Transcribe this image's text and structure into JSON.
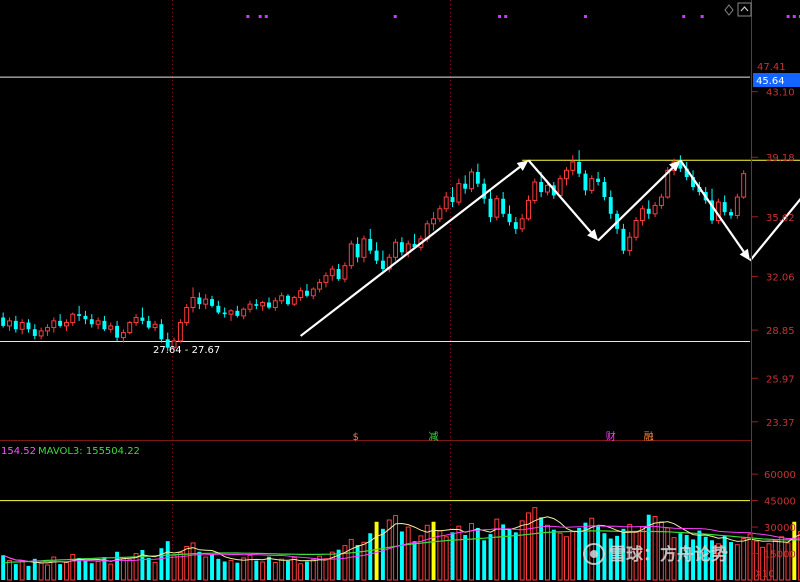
{
  "chart_data": [
    {
      "type": "candlestick",
      "panel": "price",
      "y_ticks": [
        "43.10",
        "39.18",
        "35.62",
        "32.06",
        "28.85",
        "25.97",
        "23.37"
      ],
      "y_tick_values": [
        43.1,
        39.18,
        35.62,
        32.06,
        28.85,
        25.97,
        23.37
      ],
      "ylim": [
        22.4,
        48.1
      ],
      "top_tick_partial": "47.41",
      "current_price_tag": "45.64",
      "range_label": "27.64 - 27.67",
      "horizontal_lines": [
        44.0,
        28.2
      ],
      "neckline": 39.0,
      "event_markers": [
        {
          "label": "$",
          "index": 56,
          "color": "#e87a5a"
        },
        {
          "label": "减",
          "index": 68,
          "color": "#3cdc3c"
        },
        {
          "label": "财",
          "index": 96,
          "color": "#ff3cff"
        },
        {
          "label": "融",
          "index": 102,
          "color": "#ff8a3c"
        }
      ],
      "arrows": [
        {
          "from": [
            47,
            28.5
          ],
          "to": [
            83,
            39.0
          ]
        },
        {
          "from": [
            83,
            39.0
          ],
          "to": [
            94,
            34.2
          ]
        },
        {
          "from": [
            94,
            34.2
          ],
          "to": [
            107,
            39.0
          ]
        },
        {
          "from": [
            107,
            39.0
          ],
          "to": [
            118,
            33.0
          ]
        },
        {
          "from": [
            118,
            33.0
          ],
          "to": [
            131,
            39.0
          ]
        },
        {
          "from": [
            131,
            39.0
          ],
          "to": [
            143,
            35.5
          ]
        },
        {
          "from": [
            147,
            37.0
          ],
          "to": [
            162,
            47.8
          ]
        }
      ],
      "candles": [
        [
          29.6,
          29.9,
          29.0,
          29.1
        ],
        [
          29.1,
          29.6,
          28.8,
          29.4
        ],
        [
          29.4,
          29.7,
          28.7,
          28.9
        ],
        [
          28.9,
          29.5,
          28.6,
          29.3
        ],
        [
          29.3,
          29.5,
          28.7,
          28.9
        ],
        [
          28.9,
          29.2,
          28.3,
          28.5
        ],
        [
          28.5,
          29.0,
          28.3,
          28.8
        ],
        [
          28.8,
          29.2,
          28.5,
          29.0
        ],
        [
          29.0,
          29.6,
          28.7,
          29.4
        ],
        [
          29.4,
          29.8,
          29.0,
          29.1
        ],
        [
          29.1,
          29.5,
          28.8,
          29.3
        ],
        [
          29.3,
          29.9,
          29.1,
          29.8
        ],
        [
          29.8,
          30.3,
          29.4,
          29.7
        ],
        [
          29.7,
          30.0,
          29.2,
          29.5
        ],
        [
          29.5,
          29.8,
          29.0,
          29.2
        ],
        [
          29.2,
          29.6,
          28.9,
          29.4
        ],
        [
          29.4,
          29.7,
          28.8,
          28.9
        ],
        [
          28.9,
          29.3,
          28.7,
          29.1
        ],
        [
          29.1,
          29.4,
          28.2,
          28.4
        ],
        [
          28.4,
          28.9,
          28.1,
          28.7
        ],
        [
          28.7,
          29.4,
          28.6,
          29.3
        ],
        [
          29.3,
          29.8,
          29.1,
          29.6
        ],
        [
          29.6,
          30.2,
          29.2,
          29.4
        ],
        [
          29.4,
          29.7,
          28.9,
          29.0
        ],
        [
          29.0,
          29.4,
          28.8,
          29.2
        ],
        [
          29.2,
          29.5,
          28.1,
          28.3
        ],
        [
          28.3,
          28.7,
          27.6,
          27.8
        ],
        [
          27.8,
          28.4,
          27.6,
          28.2
        ],
        [
          28.2,
          29.5,
          28.1,
          29.3
        ],
        [
          29.3,
          30.4,
          29.1,
          30.2
        ],
        [
          30.2,
          31.4,
          29.9,
          30.8
        ],
        [
          30.8,
          31.1,
          30.1,
          30.4
        ],
        [
          30.4,
          31.0,
          30.1,
          30.7
        ],
        [
          30.7,
          30.9,
          30.2,
          30.3
        ],
        [
          30.3,
          30.6,
          29.8,
          29.9
        ],
        [
          29.9,
          30.2,
          29.6,
          29.8
        ],
        [
          29.8,
          30.1,
          29.4,
          30.0
        ],
        [
          30.0,
          30.3,
          29.6,
          29.7
        ],
        [
          29.7,
          30.2,
          29.5,
          30.1
        ],
        [
          30.1,
          30.6,
          29.9,
          30.4
        ],
        [
          30.4,
          30.7,
          30.1,
          30.3
        ],
        [
          30.3,
          30.6,
          30.0,
          30.5
        ],
        [
          30.5,
          30.8,
          30.1,
          30.2
        ],
        [
          30.2,
          30.8,
          30.0,
          30.6
        ],
        [
          30.6,
          31.1,
          30.4,
          30.9
        ],
        [
          30.9,
          31.0,
          30.3,
          30.4
        ],
        [
          30.4,
          30.9,
          30.3,
          30.8
        ],
        [
          30.8,
          31.4,
          30.6,
          31.2
        ],
        [
          31.2,
          31.6,
          30.8,
          30.9
        ],
        [
          30.9,
          31.4,
          30.7,
          31.3
        ],
        [
          31.3,
          31.9,
          31.1,
          31.7
        ],
        [
          31.7,
          32.3,
          31.4,
          32.1
        ],
        [
          32.1,
          32.7,
          31.8,
          32.5
        ],
        [
          32.5,
          32.8,
          31.8,
          31.9
        ],
        [
          31.9,
          32.9,
          31.7,
          32.7
        ],
        [
          32.7,
          34.2,
          32.5,
          34.0
        ],
        [
          34.0,
          34.4,
          32.9,
          33.2
        ],
        [
          33.2,
          34.5,
          32.9,
          34.3
        ],
        [
          34.3,
          34.9,
          33.4,
          33.6
        ],
        [
          33.6,
          34.1,
          32.8,
          33.0
        ],
        [
          33.0,
          33.6,
          32.3,
          32.5
        ],
        [
          32.5,
          33.4,
          32.3,
          33.2
        ],
        [
          33.2,
          34.3,
          33.0,
          34.1
        ],
        [
          34.1,
          34.4,
          33.3,
          33.5
        ],
        [
          33.5,
          34.2,
          33.2,
          34.0
        ],
        [
          34.0,
          34.6,
          33.7,
          33.8
        ],
        [
          33.8,
          34.5,
          33.6,
          34.3
        ],
        [
          34.3,
          35.4,
          34.1,
          35.2
        ],
        [
          35.2,
          35.9,
          34.8,
          35.5
        ],
        [
          35.5,
          36.3,
          35.3,
          36.1
        ],
        [
          36.1,
          37.1,
          35.9,
          36.8
        ],
        [
          36.8,
          37.4,
          36.2,
          36.5
        ],
        [
          36.5,
          37.9,
          36.3,
          37.6
        ],
        [
          37.6,
          38.1,
          37.0,
          37.3
        ],
        [
          37.3,
          38.5,
          37.1,
          38.3
        ],
        [
          38.3,
          38.8,
          37.4,
          37.6
        ],
        [
          37.6,
          37.9,
          36.4,
          36.7
        ],
        [
          36.7,
          37.3,
          35.3,
          35.6
        ],
        [
          35.6,
          36.9,
          35.4,
          36.7
        ],
        [
          36.7,
          37.1,
          35.6,
          35.8
        ],
        [
          35.8,
          36.3,
          35.1,
          35.3
        ],
        [
          35.3,
          35.6,
          34.6,
          34.9
        ],
        [
          34.9,
          35.8,
          34.7,
          35.5
        ],
        [
          35.5,
          36.9,
          35.4,
          36.6
        ],
        [
          36.6,
          37.9,
          36.4,
          37.7
        ],
        [
          37.7,
          38.3,
          36.8,
          37.1
        ],
        [
          37.1,
          37.8,
          36.9,
          37.5
        ],
        [
          37.5,
          37.7,
          36.7,
          36.9
        ],
        [
          36.9,
          38.1,
          36.8,
          37.9
        ],
        [
          37.9,
          38.6,
          37.5,
          38.4
        ],
        [
          38.4,
          39.3,
          38.1,
          38.9
        ],
        [
          38.9,
          39.6,
          38.0,
          38.2
        ],
        [
          38.2,
          38.4,
          36.9,
          37.2
        ],
        [
          37.2,
          38.1,
          37.0,
          37.9
        ],
        [
          37.9,
          38.3,
          37.5,
          37.7
        ],
        [
          37.7,
          38.0,
          36.6,
          36.8
        ],
        [
          36.8,
          37.2,
          35.5,
          35.8
        ],
        [
          35.8,
          36.0,
          34.6,
          34.9
        ],
        [
          34.9,
          35.2,
          33.4,
          33.6
        ],
        [
          33.6,
          34.7,
          33.3,
          34.4
        ],
        [
          34.4,
          35.6,
          34.2,
          35.4
        ],
        [
          35.4,
          36.3,
          35.1,
          36.1
        ],
        [
          36.1,
          36.6,
          35.5,
          35.8
        ],
        [
          35.8,
          36.5,
          35.6,
          36.3
        ],
        [
          36.3,
          37.0,
          36.1,
          36.8
        ],
        [
          36.8,
          38.6,
          36.7,
          38.4
        ],
        [
          38.4,
          39.1,
          38.1,
          38.9
        ],
        [
          38.9,
          39.3,
          38.3,
          38.5
        ],
        [
          38.5,
          38.9,
          37.8,
          38.0
        ],
        [
          38.0,
          38.4,
          37.2,
          37.4
        ],
        [
          37.4,
          37.7,
          36.9,
          37.1
        ],
        [
          37.1,
          37.4,
          36.4,
          36.6
        ],
        [
          36.6,
          37.3,
          35.2,
          35.4
        ],
        [
          35.4,
          36.7,
          35.2,
          36.5
        ],
        [
          36.5,
          36.9,
          35.7,
          35.9
        ],
        [
          35.9,
          36.1,
          35.5,
          35.7
        ],
        [
          35.7,
          37.0,
          35.5,
          36.8
        ],
        [
          36.8,
          38.4,
          36.7,
          38.2
        ]
      ]
    },
    {
      "type": "bar",
      "panel": "volume",
      "title_values": [
        "154.52",
        "MAVOL3: 155504.22"
      ],
      "y_ticks": [
        "60000",
        "45000",
        "30000",
        "15000"
      ],
      "y_tick_values": [
        60000,
        45000,
        30000,
        15000
      ],
      "ylim": [
        0,
        68000
      ],
      "axis_unit": "X10",
      "horizontal_line": 45000,
      "highlight_color": "#ffff00",
      "highlight_indices": [
        59,
        68,
        125,
        145
      ],
      "volumes": [
        14000,
        11000,
        9000,
        10500,
        8000,
        12000,
        9500,
        8500,
        13000,
        9000,
        10000,
        14500,
        12500,
        11000,
        9500,
        10500,
        13000,
        9000,
        16000,
        12000,
        11500,
        15000,
        17000,
        12500,
        10000,
        18000,
        22000,
        14000,
        15500,
        19000,
        21000,
        16000,
        13000,
        14500,
        12000,
        10500,
        11000,
        9800,
        12500,
        14000,
        11000,
        10200,
        13200,
        9900,
        11800,
        10900,
        12700,
        9200,
        10400,
        11600,
        13500,
        12100,
        15800,
        17200,
        19500,
        23000,
        19800,
        21400,
        26500,
        33000,
        29000,
        34000,
        36500,
        27500,
        30000,
        22000,
        25000,
        31000,
        33000,
        28000,
        24500,
        27000,
        30500,
        25500,
        32000,
        29500,
        22500,
        26000,
        34500,
        31500,
        28500,
        27000,
        33500,
        38000,
        41000,
        35500,
        31000,
        28500,
        26500,
        24500,
        27500,
        29500,
        32500,
        35000,
        30500,
        26500,
        23500,
        25000,
        29000,
        31500,
        27000,
        30000,
        37000,
        36000,
        33000,
        29500,
        24000,
        26500,
        25500,
        23000,
        28000,
        24500,
        22500,
        20500,
        25000,
        21500,
        20000,
        23500,
        26000,
        22000,
        18500,
        20500,
        22500,
        24500,
        21000,
        33000,
        27500,
        24000,
        19500,
        21000,
        23000,
        18500,
        20500,
        19000,
        22000,
        25500,
        23500,
        21500,
        19000,
        20000,
        24000,
        20500,
        22500,
        24500,
        23000,
        25000
      ],
      "mavol_line": [
        9500,
        10100,
        10200,
        10300,
        10500,
        10700,
        10900,
        11100,
        11200,
        11400,
        11500,
        11700,
        11900,
        12100,
        12200,
        12400,
        12500,
        12600,
        12700,
        12800,
        13000,
        13100,
        13300,
        13500,
        13700,
        13900,
        14100,
        14300,
        14500,
        14700,
        14900,
        15000,
        15100,
        15200,
        15300,
        15300,
        15300,
        15300,
        15200,
        15200,
        15100,
        15000,
        14900,
        14800,
        14700,
        14700,
        14600,
        14500,
        14500,
        14500,
        14500,
        14600,
        14700,
        14900,
        15100,
        15400,
        15800,
        16200,
        16700,
        17300,
        17900,
        18500,
        19100,
        19600,
        20100,
        20500,
        20900,
        21300,
        21700,
        22000,
        22300,
        22600,
        22800,
        23000,
        23200,
        23500,
        23700,
        24000,
        24300,
        24600,
        24900,
        25200,
        25500,
        25900,
        26300,
        26700,
        27000,
        27200,
        27300,
        27400,
        27500,
        27600,
        27700,
        27800,
        27800,
        27800,
        27700,
        27600,
        27500,
        27500,
        27500,
        27500,
        27500,
        27500,
        27400,
        27300,
        27100,
        26900,
        26700,
        26500,
        26300,
        26000,
        25700,
        25400,
        25100,
        24800,
        24500,
        24200,
        23900,
        23600,
        23300,
        23100,
        22900,
        22800,
        22700,
        22700,
        22700,
        22600,
        22500,
        22300,
        22200,
        22100,
        22000,
        21900,
        21900,
        21900,
        21900,
        21800,
        21700,
        21600,
        21600,
        21600,
        21700,
        21800,
        21900,
        22000
      ]
    }
  ]
}
